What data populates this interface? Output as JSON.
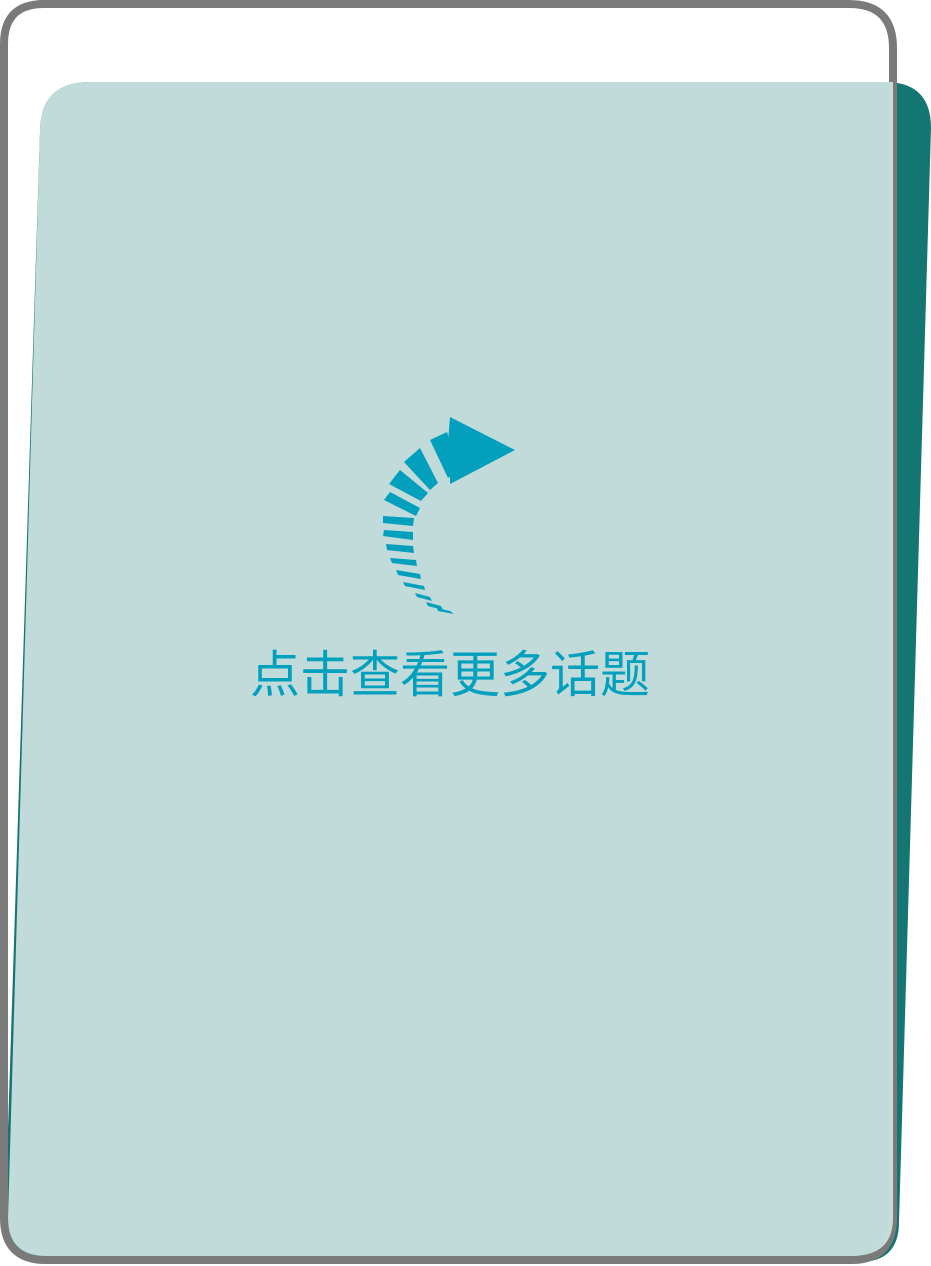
{
  "card": {
    "more_label": "点击查看更多话题",
    "icon": "curved-arrow-icon"
  },
  "colors": {
    "back_card": "#147672",
    "front_card": "#cfe2e2",
    "front_border": "#7a7a7a",
    "accent": "#03a0be"
  }
}
